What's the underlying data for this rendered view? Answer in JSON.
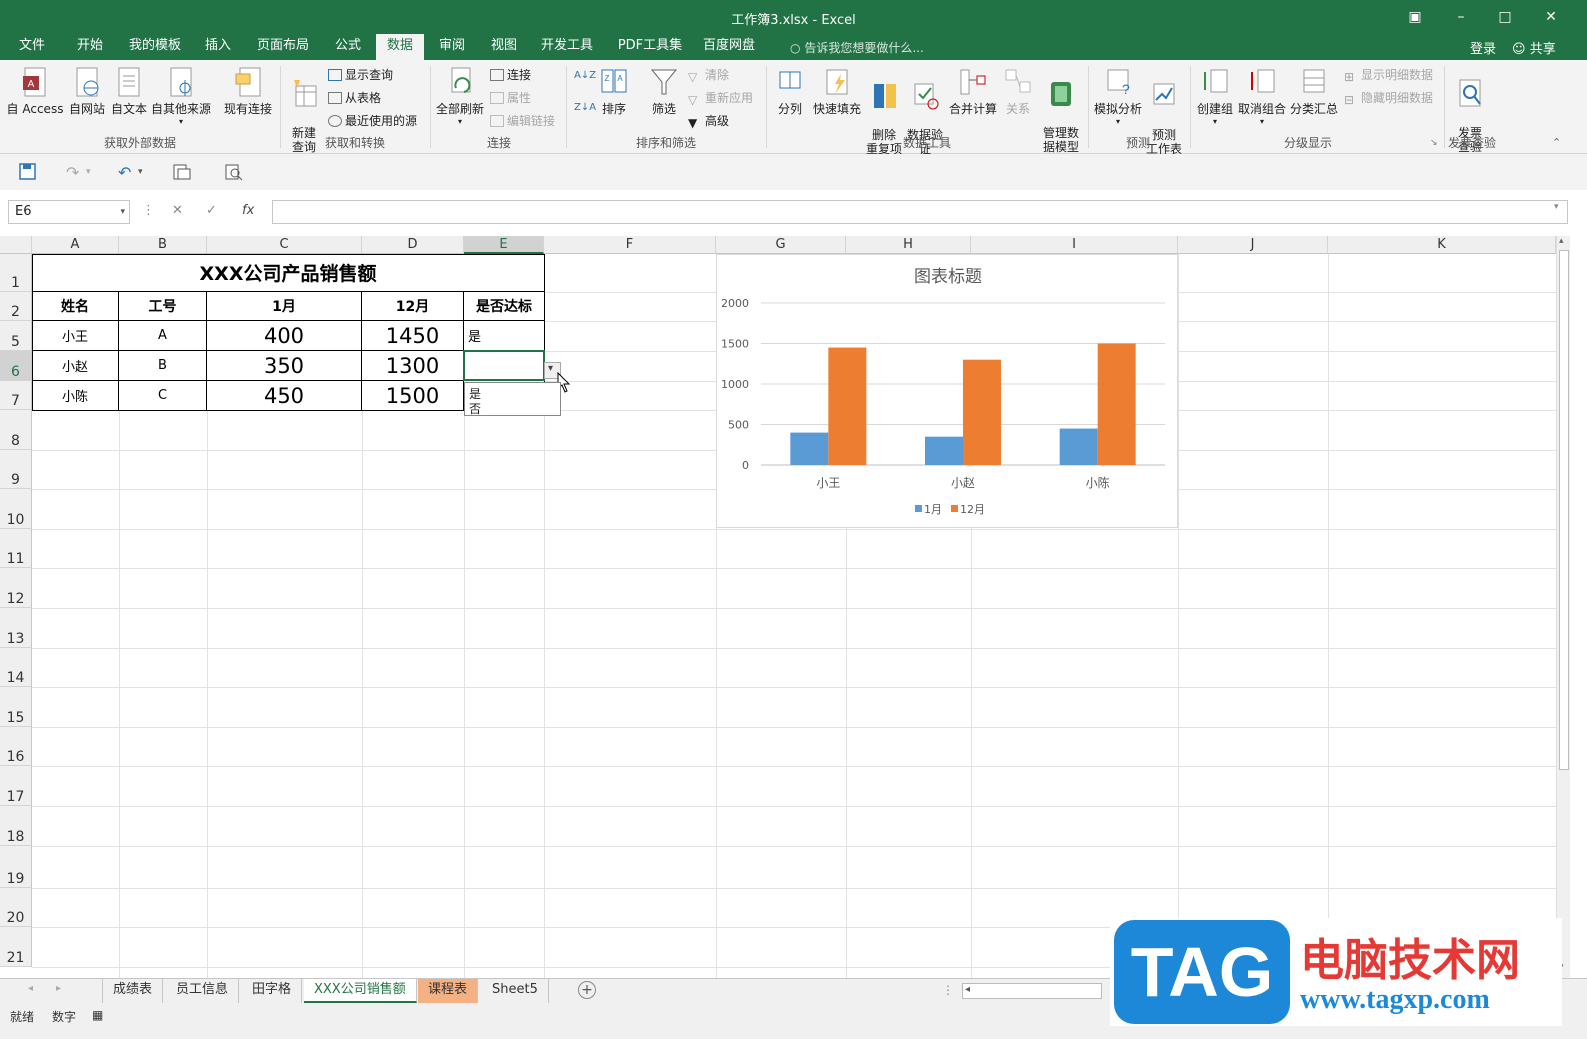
{
  "window": {
    "title": "工作簿3.xlsx - Excel",
    "controls": [
      "restore-ribbon",
      "minimize",
      "maximize",
      "close"
    ]
  },
  "tabs": [
    "文件",
    "开始",
    "我的模板",
    "插入",
    "页面布局",
    "公式",
    "数据",
    "审阅",
    "视图",
    "开发工具",
    "PDF工具集",
    "百度网盘"
  ],
  "active_tab": "数据",
  "tellme": "告诉我您想要做什么...",
  "login": "登录",
  "share": "共享",
  "ribbon": {
    "get_external": {
      "label": "获取外部数据",
      "buttons": [
        "自 Access",
        "自网站",
        "自文本",
        "自其他来源",
        "现有连接"
      ]
    },
    "transform": {
      "label": "获取和转换",
      "new_query": "新建\n查询",
      "small": [
        "显示查询",
        "从表格",
        "最近使用的源"
      ]
    },
    "connections": {
      "label": "连接",
      "refresh_all": "全部刷新",
      "small": [
        "连接",
        "属性",
        "编辑链接"
      ]
    },
    "sort_filter": {
      "label": "排序和筛选",
      "sort": "排序",
      "filter": "筛选",
      "small": [
        "清除",
        "重新应用",
        "高级"
      ]
    },
    "data_tools": {
      "label": "数据工具",
      "buttons": [
        "分列",
        "快速填充",
        "删除\n重复项",
        "数据验\n证",
        "合并计算",
        "关系",
        "管理数\n据模型"
      ]
    },
    "forecast": {
      "label": "预测",
      "buttons": [
        "模拟分析",
        "预测\n工作表"
      ]
    },
    "outline": {
      "label": "分级显示",
      "buttons": [
        "创建组",
        "取消组合",
        "分类汇总"
      ],
      "small": [
        "显示明细数据",
        "隐藏明细数据"
      ]
    },
    "invoice": {
      "label": "发票查验",
      "button": "发票\n查验"
    }
  },
  "formula_bar": {
    "name_box": "E6",
    "formula": "",
    "fx": "fx"
  },
  "columns": [
    "A",
    "B",
    "C",
    "D",
    "E",
    "F",
    "G",
    "H",
    "I",
    "J",
    "K"
  ],
  "rows": [
    "1",
    "2",
    "5",
    "6",
    "7",
    "8",
    "9",
    "10",
    "11",
    "12",
    "13",
    "14",
    "15",
    "16",
    "17",
    "18",
    "19",
    "20",
    "21"
  ],
  "table": {
    "title": "XXX公司产品销售额",
    "headers": [
      "姓名",
      "工号",
      "1月",
      "12月",
      "是否达标"
    ],
    "rows": [
      [
        "小王",
        "A",
        "400",
        "1450",
        "是"
      ],
      [
        "小赵",
        "B",
        "350",
        "1300",
        ""
      ],
      [
        "小陈",
        "C",
        "450",
        "1500",
        ""
      ]
    ]
  },
  "dropdown_options": [
    "是",
    "否"
  ],
  "chart_data": {
    "type": "bar",
    "title": "图表标题",
    "categories": [
      "小王",
      "小赵",
      "小陈"
    ],
    "series": [
      {
        "name": "1月",
        "values": [
          400,
          350,
          450
        ],
        "color": "#5b9bd5"
      },
      {
        "name": "12月",
        "values": [
          1450,
          1300,
          1500
        ],
        "color": "#ed7d31"
      }
    ],
    "yticks": [
      "0",
      "500",
      "1000",
      "1500",
      "2000"
    ],
    "ylim": [
      0,
      2000
    ],
    "grid": true,
    "legend": "bottom"
  },
  "sheets": [
    "成绩表",
    "员工信息",
    "田字格",
    "XXX公司销售额",
    "课程表",
    "Sheet5"
  ],
  "active_sheet": "XXX公司销售额",
  "status": {
    "ready": "就绪",
    "mode": "数字"
  },
  "watermark": {
    "logo": "TAG",
    "text": "电脑技术网",
    "url": "www.tagxp.com"
  },
  "colors": {
    "brand": "#217346",
    "series1": "#5b9bd5",
    "series2": "#ed7d31",
    "orange_tab": "#f4b183"
  }
}
